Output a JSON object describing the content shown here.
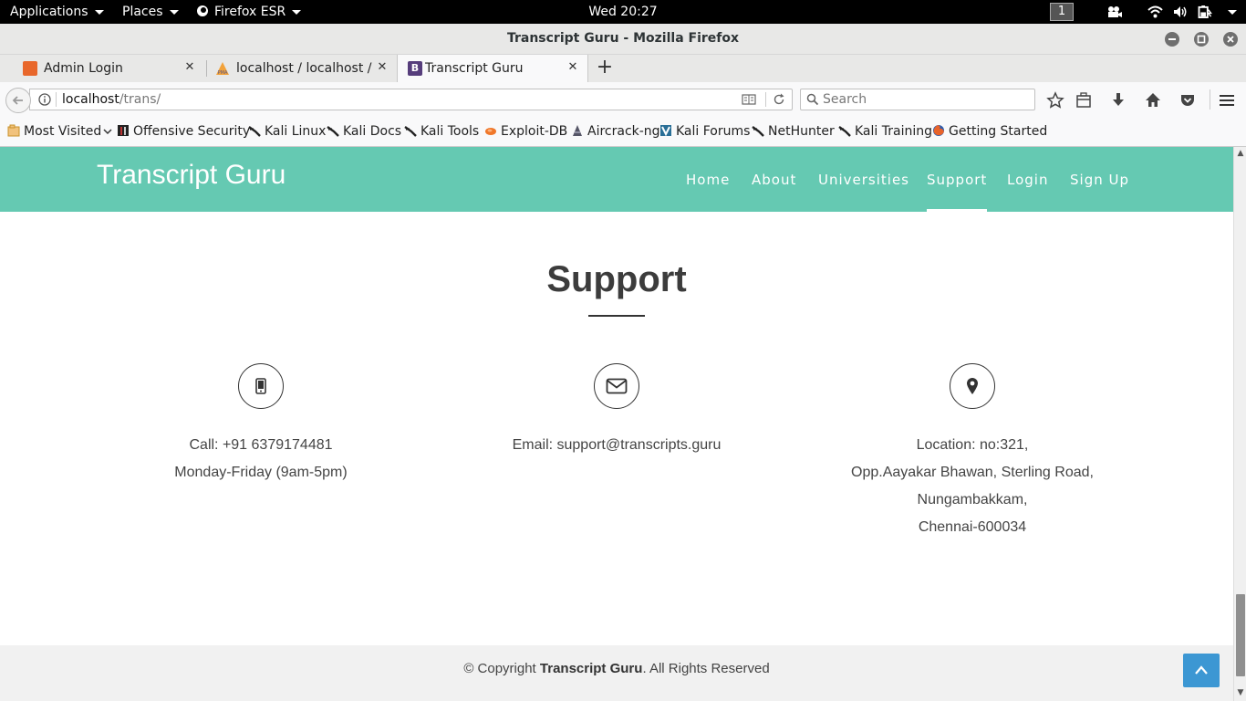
{
  "system_bar": {
    "applications": "Applications",
    "places": "Places",
    "firefox": "Firefox ESR",
    "clock": "Wed 20:27",
    "workspace": "1"
  },
  "window": {
    "title": "Transcript Guru - Mozilla Firefox"
  },
  "tabs": [
    {
      "label": "Admin Login",
      "favicon_color": "#e8672b"
    },
    {
      "label": "localhost / localhost /...",
      "favicon_color": "#f2a23a"
    },
    {
      "label": "Transcript Guru",
      "favicon_color": "#563d7c"
    }
  ],
  "navbar": {
    "url_host": "localhost",
    "url_path": "/trans/",
    "search_placeholder": "Search"
  },
  "bookmarks": [
    {
      "label": "Most Visited"
    },
    {
      "label": "Offensive Security"
    },
    {
      "label": "Kali Linux"
    },
    {
      "label": "Kali Docs"
    },
    {
      "label": "Kali Tools"
    },
    {
      "label": "Exploit-DB"
    },
    {
      "label": "Aircrack-ng"
    },
    {
      "label": "Kali Forums"
    },
    {
      "label": "NetHunter"
    },
    {
      "label": "Kali Training"
    },
    {
      "label": "Getting Started"
    }
  ],
  "site": {
    "brand": "Transcript Guru",
    "header_color": "#65c9b2",
    "nav": [
      {
        "label": "Home"
      },
      {
        "label": "About"
      },
      {
        "label": "Universities"
      },
      {
        "label": "Support",
        "active": true
      },
      {
        "label": "Login"
      },
      {
        "label": "Sign Up"
      }
    ],
    "support": {
      "title": "Support",
      "call": {
        "line1": "Call: +91 6379174481",
        "line2": "Monday-Friday (9am-5pm)",
        "icon": "mobile-icon"
      },
      "email": {
        "line1": "Email: support@transcripts.guru",
        "icon": "envelope-icon"
      },
      "location": {
        "line1": "Location: no:321,",
        "line2": "Opp.Aayakar Bhawan, Sterling Road,",
        "line3": "Nungambakkam,",
        "line4": "Chennai-600034",
        "icon": "map-marker-icon"
      }
    },
    "footer": {
      "prefix": "© Copyright ",
      "brand": "Transcript Guru",
      "suffix": ". All Rights Reserved"
    },
    "back_to_top_color": "#3c97d3"
  }
}
